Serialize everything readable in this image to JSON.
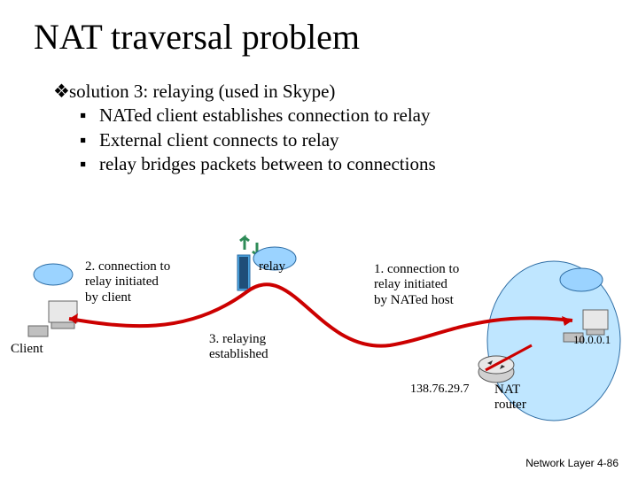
{
  "title": "NAT traversal problem",
  "bullets": {
    "lead": "solution 3: relaying (used in Skype)",
    "s1": "NATed client establishes connection to relay",
    "s2": "External client connects to relay",
    "s3": "relay bridges packets between to connections"
  },
  "labels": {
    "step2": "2. connection to\nrelay initiated\nby client",
    "step3": "3. relaying\nestablished",
    "step1": "1. connection to\nrelay initiated\nby NATed host",
    "client": "Client",
    "relay": "relay",
    "nat_router": "NAT\nrouter",
    "ip_outer": "138.76.29.7",
    "ip_inner": "10.0.0.1"
  },
  "footer": {
    "section": "Network Layer",
    "page": "4-86"
  }
}
